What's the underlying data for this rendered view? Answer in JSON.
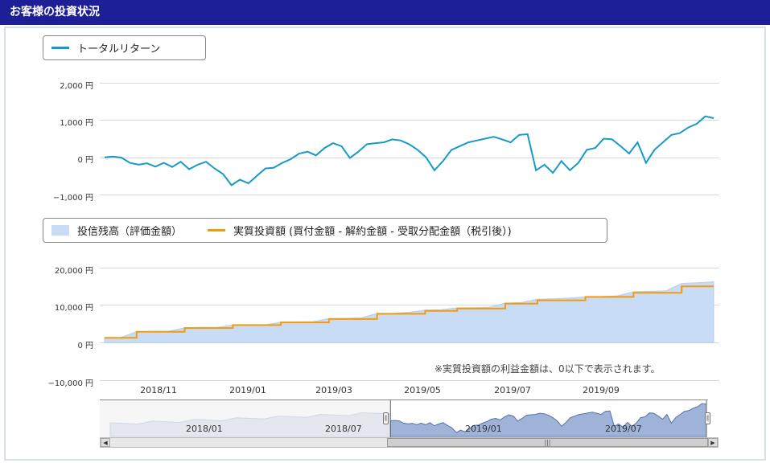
{
  "header": {
    "title": "お客様の投資状況"
  },
  "colors": {
    "header_bg": "#1c1f96",
    "total_return": "#169ac8",
    "balance_fill": "#c9dcf5",
    "investment": "#f59a0c",
    "navigator_fill": "#9fb3d8"
  },
  "chart_data": [
    {
      "type": "line",
      "legend": [
        "トータルリターン"
      ],
      "series": [
        {
          "name": "トータルリターン",
          "values": [
            0,
            20,
            -10,
            -150,
            -200,
            -160,
            -250,
            -150,
            -260,
            -120,
            -320,
            -200,
            -120,
            -300,
            -450,
            -750,
            -600,
            -700,
            -500,
            -300,
            -280,
            -150,
            -50,
            100,
            150,
            50,
            250,
            380,
            300,
            -20,
            150,
            350,
            380,
            400,
            480,
            450,
            350,
            200,
            0,
            -350,
            -100,
            200,
            300,
            400,
            450,
            500,
            550,
            480,
            400,
            600,
            620,
            -350,
            -200,
            -420,
            -100,
            -350,
            -150,
            200,
            250,
            500,
            480,
            300,
            100,
            400,
            -150,
            200,
            400,
            600,
            650,
            800,
            900,
            1100,
            1050
          ],
          "unit": "円"
        }
      ],
      "yticks": [
        "2,000 円",
        "1,000 円",
        "0 円",
        "−1,000 円"
      ],
      "ylim": [
        -1000,
        2000
      ]
    },
    {
      "type": "area",
      "legend": [
        "投信残高（評価金額）",
        "実質投資額 (買付金額 - 解約金額 - 受取分配金額（税引後）)"
      ],
      "series": [
        {
          "name": "投信残高（評価金額）",
          "values": [
            1300,
            1350,
            2950,
            3000,
            3050,
            4000,
            4100,
            4050,
            4700,
            4800,
            4750,
            5500,
            5550,
            5600,
            6450,
            6500,
            6600,
            7800,
            7850,
            8100,
            8700,
            8800,
            9300,
            9350,
            9450,
            10600,
            10700,
            11600,
            11700,
            11900,
            12200,
            12300,
            12500,
            13600,
            13700,
            13800,
            15800,
            16000,
            16200
          ]
        },
        {
          "name": "実質投資額 (買付金額 - 解約金額 - 受取分配金額（税引後）)",
          "values": [
            1300,
            1300,
            2900,
            2900,
            2900,
            3900,
            3900,
            3900,
            4700,
            4700,
            4700,
            5400,
            5400,
            5400,
            6300,
            6300,
            6300,
            7700,
            7700,
            7700,
            8500,
            8500,
            9100,
            9100,
            9100,
            10400,
            10400,
            11300,
            11300,
            11300,
            12200,
            12200,
            12200,
            13300,
            13300,
            13300,
            15000,
            15000,
            15000
          ]
        }
      ],
      "yticks": [
        "20,000 円",
        "10,000 円",
        "0 円",
        "−10,000 円"
      ],
      "ylim": [
        -10000,
        20000
      ],
      "xticks": [
        "2018/11",
        "2019/01",
        "2019/03",
        "2019/05",
        "2019/07",
        "2019/09"
      ]
    }
  ],
  "note": "※実質投資額の利益金額は、0以下で表示されます。",
  "navigator": {
    "xticks": [
      "2018/01",
      "2018/07",
      "2019/01",
      "2019/07"
    ],
    "handle_left": "‖",
    "handle_right": "‖",
    "scroll_left": "◀",
    "scroll_right": "▶",
    "thumb_grip": "|||",
    "selected_from": 0.47,
    "selected_to": 1.0
  }
}
